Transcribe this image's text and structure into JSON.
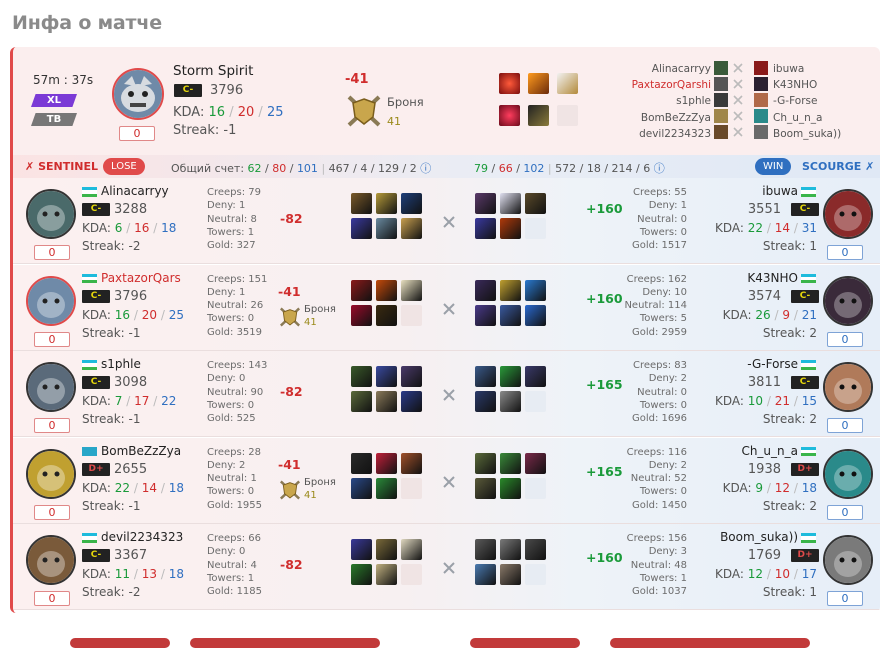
{
  "page_title": "Инфа о матче",
  "hero": {
    "duration": "57m : 37s",
    "badge1": "XL",
    "badge2": "TB",
    "hero_name": "Storm Spirit",
    "rank": "C-",
    "mmr": "3796",
    "kda_label": "KDA:",
    "kills": "16",
    "deaths": "20",
    "assists": "25",
    "streak": "Streak: -1",
    "count": "0",
    "diff": "-41",
    "armor_label": "Броня",
    "armor": "41"
  },
  "hero_teams": {
    "sentinel": [
      "Alinacarryy",
      "PaxtazorQarshi",
      "s1phle",
      "BomBeZzZya",
      "devil2234323"
    ],
    "scourge": [
      "ibuwa",
      "K43NHO",
      "-G-Forse",
      "Ch_u_n_a",
      "Boom_suka))"
    ]
  },
  "bar": {
    "sentinel": "SENTINEL",
    "lose": "LOSE",
    "score_label": "Общий счет:",
    "s_k": "62",
    "s_d": "80",
    "s_a": "101",
    "s_extra": "467 / 4 / 129 / 2",
    "sc_k": "79",
    "sc_d": "66",
    "sc_a": "102",
    "sc_extra": "572 / 18 / 214 / 6",
    "win": "WIN",
    "scourge": "SCOURGE"
  },
  "labels": {
    "creeps": "Creeps:",
    "deny": "Deny:",
    "neutral": "Neutral:",
    "towers": "Towers:",
    "gold": "Gold:",
    "kda": "KDA:",
    "armor": "Броня"
  },
  "rows": [
    {
      "left": {
        "name": "Alinacarryy",
        "rank": "C-",
        "mmr": "3288",
        "k": "6",
        "d": "16",
        "a": "18",
        "streak": "Streak: -2",
        "count": "0",
        "creeps": "79",
        "deny": "1",
        "neutral": "8",
        "towers": "1",
        "gold": "327",
        "diff": "-82"
      },
      "right": {
        "name": "ibuwa",
        "rank": "C-",
        "mmr": "3551",
        "k": "22",
        "d": "14",
        "a": "31",
        "streak": "Streak: 1",
        "count": "0",
        "creeps": "55",
        "deny": "1",
        "neutral": "0",
        "towers": "0",
        "gold": "1517",
        "diff": "+160"
      }
    },
    {
      "left": {
        "name": "PaxtazorQars",
        "rank": "C-",
        "mmr": "3796",
        "k": "16",
        "d": "20",
        "a": "25",
        "streak": "Streak: -1",
        "count": "0",
        "creeps": "151",
        "deny": "1",
        "neutral": "26",
        "towers": "0",
        "gold": "3519",
        "diff": "-41",
        "armor": "41"
      },
      "right": {
        "name": "K43NHO",
        "rank": "C-",
        "mmr": "3574",
        "k": "26",
        "d": "9",
        "a": "21",
        "streak": "Streak: 2",
        "count": "0",
        "creeps": "162",
        "deny": "10",
        "neutral": "114",
        "towers": "5",
        "gold": "2959",
        "diff": "+160"
      }
    },
    {
      "left": {
        "name": "s1phle",
        "rank": "C-",
        "mmr": "3098",
        "k": "7",
        "d": "17",
        "a": "22",
        "streak": "Streak: -1",
        "count": "0",
        "creeps": "143",
        "deny": "0",
        "neutral": "90",
        "towers": "0",
        "gold": "525",
        "diff": "-82"
      },
      "right": {
        "name": "-G-Forse",
        "rank": "C-",
        "mmr": "3811",
        "k": "10",
        "d": "21",
        "a": "15",
        "streak": "Streak: 2",
        "count": "0",
        "creeps": "83",
        "deny": "2",
        "neutral": "0",
        "towers": "0",
        "gold": "1696",
        "diff": "+165"
      }
    },
    {
      "left": {
        "name": "BomBeZzZya",
        "rank": "D+",
        "mmr": "2655",
        "k": "22",
        "d": "14",
        "a": "18",
        "streak": "Streak: -1",
        "count": "0",
        "creeps": "28",
        "deny": "2",
        "neutral": "1",
        "towers": "0",
        "gold": "1955",
        "diff": "-41",
        "armor": "41"
      },
      "right": {
        "name": "Ch_u_n_a",
        "rank": "D+",
        "mmr": "1938",
        "k": "9",
        "d": "12",
        "a": "18",
        "streak": "Streak: 2",
        "count": "0",
        "creeps": "116",
        "deny": "2",
        "neutral": "52",
        "towers": "0",
        "gold": "1450",
        "diff": "+165"
      }
    },
    {
      "left": {
        "name": "devil2234323",
        "rank": "C-",
        "mmr": "3367",
        "k": "11",
        "d": "13",
        "a": "18",
        "streak": "Streak: -2",
        "count": "0",
        "creeps": "66",
        "deny": "0",
        "neutral": "4",
        "towers": "1",
        "gold": "1185",
        "diff": "-82"
      },
      "right": {
        "name": "Boom_suka))",
        "rank": "D+",
        "mmr": "1769",
        "k": "12",
        "d": "10",
        "a": "17",
        "streak": "Streak: 1",
        "count": "0",
        "creeps": "156",
        "deny": "3",
        "neutral": "48",
        "towers": "1",
        "gold": "1037",
        "diff": "+160"
      }
    }
  ],
  "colors": {
    "red": "#d02d2d",
    "green": "#1a9a3a",
    "blue": "#2f6fc0",
    "win": "#2f6fc0",
    "lose": "#e04a4a"
  }
}
